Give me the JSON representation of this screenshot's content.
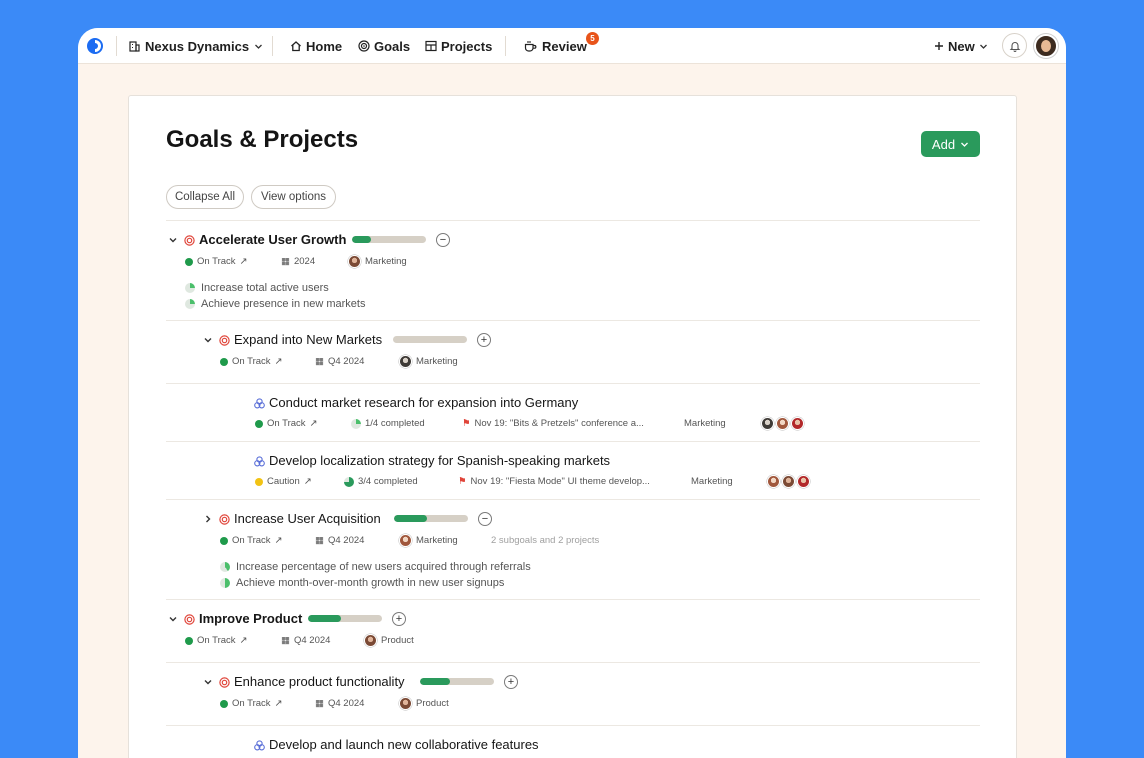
{
  "topbar": {
    "org": "Nexus Dynamics",
    "home": "Home",
    "goals": "Goals",
    "projects": "Projects",
    "review": "Review",
    "review_badge": "5",
    "new": "New"
  },
  "page": {
    "title": "Goals & Projects",
    "add": "Add",
    "collapse_all": "Collapse All",
    "view_options": "View options"
  },
  "rows": [
    {
      "title": "Accelerate User Growth",
      "progress": 0.26,
      "status": "On Track",
      "date": "2024",
      "owner": "Marketing",
      "targets": [
        "Increase total active users",
        "Achieve presence in new markets"
      ]
    },
    {
      "title": "Expand into New Markets",
      "progress": 0.0,
      "status": "On Track",
      "date": "Q4 2024",
      "owner": "Marketing"
    },
    {
      "title": "Conduct market research for expansion into Germany",
      "status": "On Track",
      "completed": "1/4 completed",
      "milestone": "Nov 19: \"Bits & Pretzels\" conference a...",
      "owner": "Marketing"
    },
    {
      "title": "Develop localization strategy for Spanish-speaking markets",
      "status": "Caution",
      "completed": "3/4 completed",
      "milestone": "Nov 19: \"Fiesta Mode\" UI theme develop...",
      "owner": "Marketing"
    },
    {
      "title": "Increase User Acquisition",
      "progress": 0.45,
      "status": "On Track",
      "date": "Q4 2024",
      "owner": "Marketing",
      "summary": "2 subgoals and 2 projects",
      "targets": [
        "Increase percentage of new users acquired through referrals",
        "Achieve month-over-month growth in new user signups"
      ]
    },
    {
      "title": "Improve Product",
      "progress": 0.44,
      "status": "On Track",
      "date": "Q4 2024",
      "owner": "Product"
    },
    {
      "title": "Enhance product functionality",
      "progress": 0.4,
      "status": "On Track",
      "date": "Q4 2024",
      "owner": "Product"
    },
    {
      "title": "Develop and launch new collaborative features"
    }
  ],
  "colors": {
    "accent": "#2a9a5c",
    "on_track": "#1f9a4b",
    "caution": "#f2c314",
    "badge": "#e8541a",
    "background": "#3b8af7"
  }
}
